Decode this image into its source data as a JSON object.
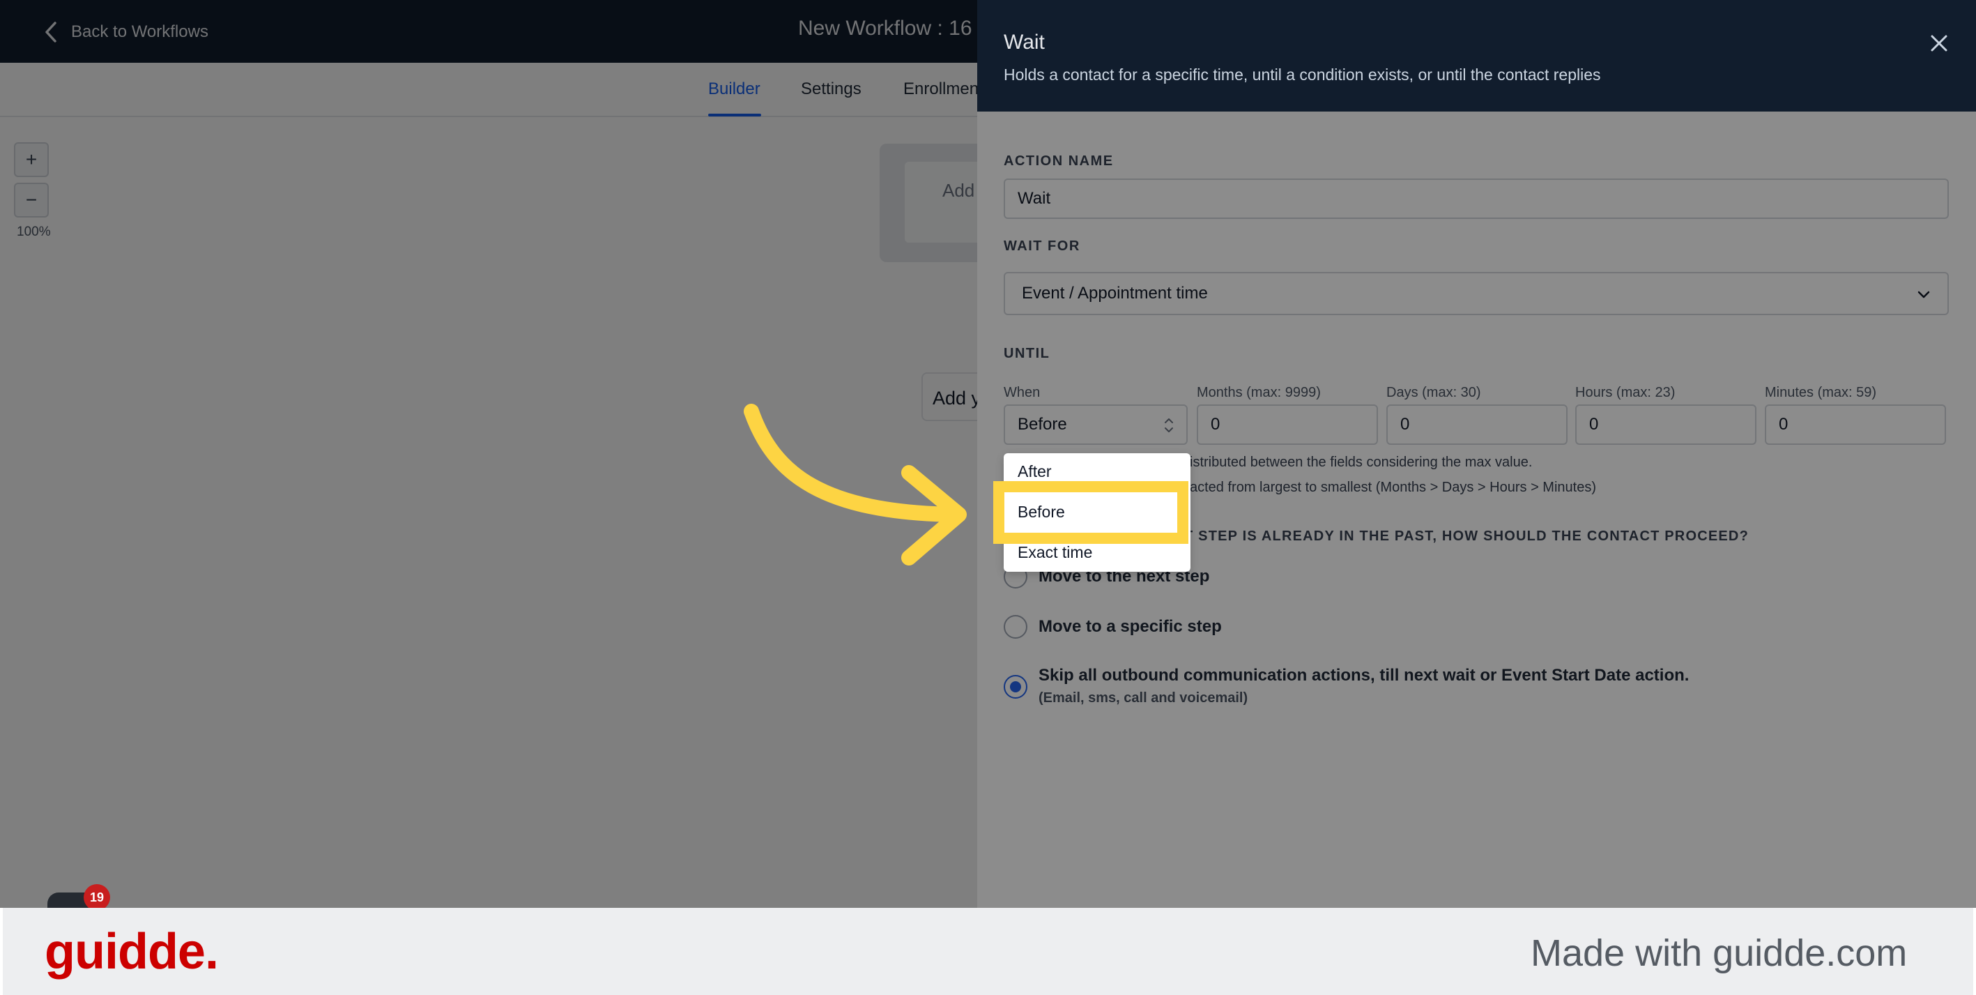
{
  "app": {
    "back_label": "Back to Workflows",
    "workflow_title": "New Workflow : 16",
    "tabs": [
      {
        "label": "Builder",
        "active": true
      },
      {
        "label": "Settings",
        "active": false
      },
      {
        "label": "Enrollment",
        "active": false
      }
    ],
    "zoom_in": "+",
    "zoom_out": "−",
    "zoom_level": "100%",
    "trigger_placeholder": "Add",
    "add_action_text": "Add y",
    "chat_badge_count": "19"
  },
  "drawer": {
    "title": "Wait",
    "subtitle": "Holds a contact for a specific time, until a condition exists, or until the contact replies",
    "action_name_label": "ACTION NAME",
    "action_name_value": "Wait",
    "wait_for_label": "WAIT FOR",
    "wait_for_value": "Event / Appointment time",
    "until_label": "UNTIL",
    "when_label": "When",
    "when_value": "Before",
    "months_label": "Months (max: 9999)",
    "months_value": "0",
    "days_label": "Days (max: 30)",
    "days_value": "0",
    "hours_label": "Hours (max: 23)",
    "hours_value": "0",
    "minutes_label": "Minutes (max: 59)",
    "minutes_value": "0",
    "helper_1": "istributed between the fields considering the max value.",
    "helper_2": "acted from largest to smallest (Months > Days > Hours > Minutes)",
    "past_question": "T STEP IS ALREADY IN THE PAST, HOW SHOULD THE CONTACT PROCEED?",
    "options": [
      {
        "label": "Move to the next step",
        "checked": false
      },
      {
        "label": "Move to a specific step",
        "checked": false
      },
      {
        "label": "Skip all outbound communication actions, till next wait or Event Start Date action.",
        "sub": "(Email, sms, call and voicemail)",
        "checked": true
      }
    ]
  },
  "when_dropdown": {
    "options": [
      "After",
      "Before",
      "Exact time"
    ],
    "highlighted": "Before"
  },
  "footer": {
    "brand": "guidde.",
    "made_with": "Made with guidde.com"
  },
  "colors": {
    "header_bg": "#111d2d",
    "accent_blue": "#155eef",
    "highlight_yellow": "#fdd443",
    "brand_red": "#cc0000"
  }
}
